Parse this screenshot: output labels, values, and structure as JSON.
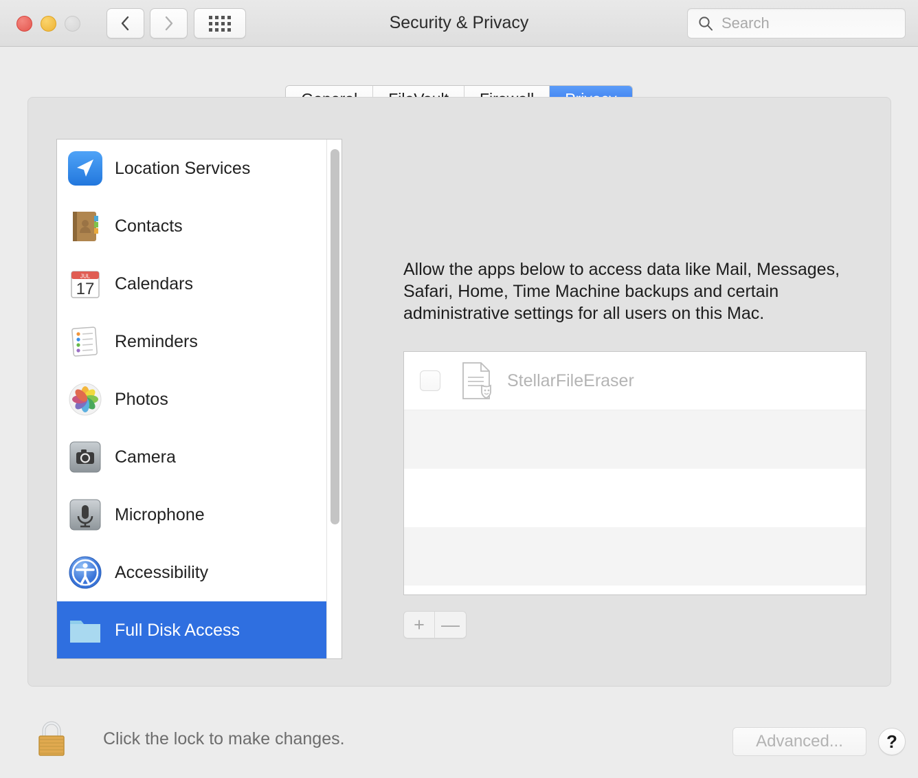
{
  "window": {
    "title": "Security & Privacy",
    "traffic_lights": [
      "close",
      "minimize",
      "zoom"
    ],
    "back_label": "Back",
    "forward_label": "Forward",
    "showall_label": "Show All"
  },
  "search": {
    "placeholder": "Search",
    "value": ""
  },
  "tabs": [
    {
      "label": "General",
      "active": false
    },
    {
      "label": "FileVault",
      "active": false
    },
    {
      "label": "Firewall",
      "active": false
    },
    {
      "label": "Privacy",
      "active": true
    }
  ],
  "sidebar": {
    "items": [
      {
        "label": "Location Services",
        "icon": "location-services-icon",
        "selected": false
      },
      {
        "label": "Contacts",
        "icon": "contacts-icon",
        "selected": false
      },
      {
        "label": "Calendars",
        "icon": "calendars-icon",
        "selected": false
      },
      {
        "label": "Reminders",
        "icon": "reminders-icon",
        "selected": false
      },
      {
        "label": "Photos",
        "icon": "photos-icon",
        "selected": false
      },
      {
        "label": "Camera",
        "icon": "camera-icon",
        "selected": false
      },
      {
        "label": "Microphone",
        "icon": "microphone-icon",
        "selected": false
      },
      {
        "label": "Accessibility",
        "icon": "accessibility-icon",
        "selected": false
      },
      {
        "label": "Full Disk Access",
        "icon": "folder-icon",
        "selected": true
      }
    ],
    "calendar_icon_month": "JUL",
    "calendar_icon_day": "17"
  },
  "detail": {
    "description": "Allow the apps below to access data like Mail, Messages, Safari, Home, Time Machine backups and certain administrative settings for all users on this Mac.",
    "apps": [
      {
        "name": "StellarFileEraser",
        "checked": false,
        "icon": "document-shield-icon"
      }
    ],
    "add_label": "+",
    "remove_label": "—"
  },
  "footer": {
    "lock_icon": "padlock-closed-icon",
    "lock_text": "Click the lock to make changes.",
    "advanced_label": "Advanced...",
    "help_label": "?"
  },
  "colors": {
    "accent_blue": "#2f6fe0",
    "tab_active_blue": "#3b7ff0",
    "window_bg": "#ececec",
    "panel_bg": "#e2e2e2",
    "list_bg": "#ffffff",
    "alt_row": "#f4f4f4",
    "disabled_text": "#b4b4b4",
    "lock_gold": "#e8b85c"
  }
}
